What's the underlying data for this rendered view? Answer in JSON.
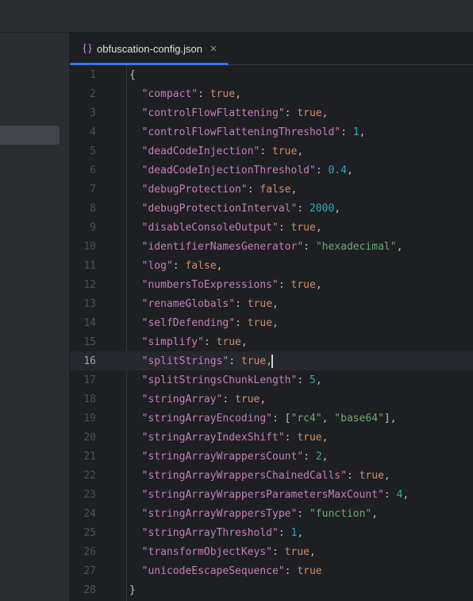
{
  "tab": {
    "label": "obfuscation-config.json",
    "icon": "json-braces-icon",
    "close_icon": "close-icon"
  },
  "colors": {
    "key": "#c77dbb",
    "string": "#6aab73",
    "keyword": "#cf8e6d",
    "number": "#2aacb8",
    "accent": "#3574f0"
  },
  "editor": {
    "current_line": 16,
    "lines": [
      {
        "num": "1",
        "tokens": [
          [
            "p",
            "{"
          ]
        ]
      },
      {
        "num": "2",
        "tokens": [
          [
            "k",
            "  \"compact\""
          ],
          [
            "p",
            ": "
          ],
          [
            "b",
            "true"
          ],
          [
            "p",
            ","
          ]
        ]
      },
      {
        "num": "3",
        "tokens": [
          [
            "k",
            "  \"controlFlowFlattening\""
          ],
          [
            "p",
            ": "
          ],
          [
            "b",
            "true"
          ],
          [
            "p",
            ","
          ]
        ]
      },
      {
        "num": "4",
        "tokens": [
          [
            "k",
            "  \"controlFlowFlatteningThreshold\""
          ],
          [
            "p",
            ": "
          ],
          [
            "n",
            "1"
          ],
          [
            "p",
            ","
          ]
        ]
      },
      {
        "num": "5",
        "tokens": [
          [
            "k",
            "  \"deadCodeInjection\""
          ],
          [
            "p",
            ": "
          ],
          [
            "b",
            "true"
          ],
          [
            "p",
            ","
          ]
        ]
      },
      {
        "num": "6",
        "tokens": [
          [
            "k",
            "  \"deadCodeInjectionThreshold\""
          ],
          [
            "p",
            ": "
          ],
          [
            "n",
            "0.4"
          ],
          [
            "p",
            ","
          ]
        ]
      },
      {
        "num": "7",
        "tokens": [
          [
            "k",
            "  \"debugProtection\""
          ],
          [
            "p",
            ": "
          ],
          [
            "b",
            "false"
          ],
          [
            "p",
            ","
          ]
        ]
      },
      {
        "num": "8",
        "tokens": [
          [
            "k",
            "  \"debugProtectionInterval\""
          ],
          [
            "p",
            ": "
          ],
          [
            "n",
            "2000"
          ],
          [
            "p",
            ","
          ]
        ]
      },
      {
        "num": "9",
        "tokens": [
          [
            "k",
            "  \"disableConsoleOutput\""
          ],
          [
            "p",
            ": "
          ],
          [
            "b",
            "true"
          ],
          [
            "p",
            ","
          ]
        ]
      },
      {
        "num": "10",
        "tokens": [
          [
            "k",
            "  \"identifierNamesGenerator\""
          ],
          [
            "p",
            ": "
          ],
          [
            "s",
            "\"hexadecimal\""
          ],
          [
            "p",
            ","
          ]
        ]
      },
      {
        "num": "11",
        "tokens": [
          [
            "k",
            "  \"log\""
          ],
          [
            "p",
            ": "
          ],
          [
            "b",
            "false"
          ],
          [
            "p",
            ","
          ]
        ]
      },
      {
        "num": "12",
        "tokens": [
          [
            "k",
            "  \"numbersToExpressions\""
          ],
          [
            "p",
            ": "
          ],
          [
            "b",
            "true"
          ],
          [
            "p",
            ","
          ]
        ]
      },
      {
        "num": "13",
        "tokens": [
          [
            "k",
            "  \"renameGlobals\""
          ],
          [
            "p",
            ": "
          ],
          [
            "b",
            "true"
          ],
          [
            "p",
            ","
          ]
        ]
      },
      {
        "num": "14",
        "tokens": [
          [
            "k",
            "  \"selfDefending\""
          ],
          [
            "p",
            ": "
          ],
          [
            "b",
            "true"
          ],
          [
            "p",
            ","
          ]
        ]
      },
      {
        "num": "15",
        "tokens": [
          [
            "k",
            "  \"simplify\""
          ],
          [
            "p",
            ": "
          ],
          [
            "b",
            "true"
          ],
          [
            "p",
            ","
          ]
        ]
      },
      {
        "num": "16",
        "tokens": [
          [
            "k",
            "  \"splitStrings\""
          ],
          [
            "p",
            ": "
          ],
          [
            "b",
            "true"
          ],
          [
            "p",
            ","
          ]
        ]
      },
      {
        "num": "17",
        "tokens": [
          [
            "k",
            "  \"splitStringsChunkLength\""
          ],
          [
            "p",
            ": "
          ],
          [
            "n",
            "5"
          ],
          [
            "p",
            ","
          ]
        ]
      },
      {
        "num": "18",
        "tokens": [
          [
            "k",
            "  \"stringArray\""
          ],
          [
            "p",
            ": "
          ],
          [
            "b",
            "true"
          ],
          [
            "p",
            ","
          ]
        ]
      },
      {
        "num": "19",
        "tokens": [
          [
            "k",
            "  \"stringArrayEncoding\""
          ],
          [
            "p",
            ": ["
          ],
          [
            "s",
            "\"rc4\""
          ],
          [
            "p",
            ", "
          ],
          [
            "s",
            "\"base64\""
          ],
          [
            "p",
            "],"
          ]
        ]
      },
      {
        "num": "20",
        "tokens": [
          [
            "k",
            "  \"stringArrayIndexShift\""
          ],
          [
            "p",
            ": "
          ],
          [
            "b",
            "true"
          ],
          [
            "p",
            ","
          ]
        ]
      },
      {
        "num": "21",
        "tokens": [
          [
            "k",
            "  \"stringArrayWrappersCount\""
          ],
          [
            "p",
            ": "
          ],
          [
            "n",
            "2"
          ],
          [
            "p",
            ","
          ]
        ]
      },
      {
        "num": "22",
        "tokens": [
          [
            "k",
            "  \"stringArrayWrappersChainedCalls\""
          ],
          [
            "p",
            ": "
          ],
          [
            "b",
            "true"
          ],
          [
            "p",
            ","
          ]
        ]
      },
      {
        "num": "23",
        "tokens": [
          [
            "k",
            "  \"stringArrayWrappersParametersMaxCount\""
          ],
          [
            "p",
            ": "
          ],
          [
            "n",
            "4"
          ],
          [
            "p",
            ","
          ]
        ]
      },
      {
        "num": "24",
        "tokens": [
          [
            "k",
            "  \"stringArrayWrappersType\""
          ],
          [
            "p",
            ": "
          ],
          [
            "s",
            "\"function\""
          ],
          [
            "p",
            ","
          ]
        ]
      },
      {
        "num": "25",
        "tokens": [
          [
            "k",
            "  \"stringArrayThreshold\""
          ],
          [
            "p",
            ": "
          ],
          [
            "n",
            "1"
          ],
          [
            "p",
            ","
          ]
        ]
      },
      {
        "num": "26",
        "tokens": [
          [
            "k",
            "  \"transformObjectKeys\""
          ],
          [
            "p",
            ": "
          ],
          [
            "b",
            "true"
          ],
          [
            "p",
            ","
          ]
        ]
      },
      {
        "num": "27",
        "tokens": [
          [
            "k",
            "  \"unicodeEscapeSequence\""
          ],
          [
            "p",
            ": "
          ],
          [
            "b",
            "true"
          ]
        ]
      },
      {
        "num": "28",
        "tokens": [
          [
            "p",
            "}"
          ]
        ]
      }
    ]
  }
}
